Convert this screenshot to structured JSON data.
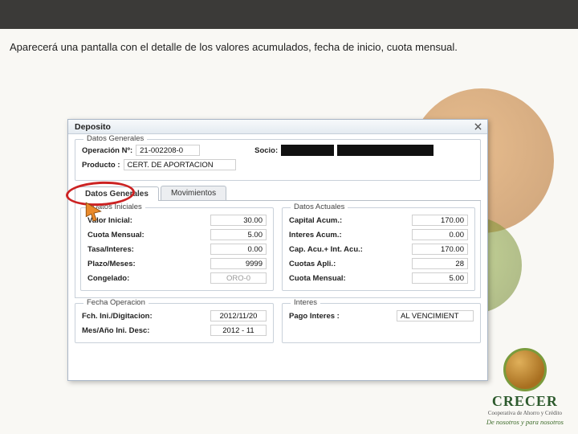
{
  "intro_text": "Aparecerá una pantalla con el detalle de los valores acumulados, fecha de inicio, cuota mensual.",
  "window": {
    "title": "Deposito"
  },
  "datos_generales": {
    "legend": "Datos Generales",
    "operacion_label": "Operación Nº:",
    "operacion_value": "21-002208-0",
    "socio_label": "Socio:",
    "producto_label": "Producto :",
    "producto_value": "CERT. DE APORTACION"
  },
  "tabs": {
    "tab1": "Datos Generales",
    "tab2": "Movimientos"
  },
  "datos_iniciales": {
    "legend": "Datos Iniciales",
    "valor_inicial_label": "Valor Inicial:",
    "valor_inicial": "30.00",
    "cuota_mensual_label": "Cuota Mensual:",
    "cuota_mensual": "5.00",
    "tasa_label": "Tasa/Interes:",
    "tasa": "0.00",
    "plazo_label": "Plazo/Meses:",
    "plazo": "9999",
    "congelado_label": "Congelado:",
    "congelado": "ORO-0"
  },
  "datos_actuales": {
    "legend": "Datos Actuales",
    "capital_label": "Capital Acum.:",
    "capital": "170.00",
    "interes_label": "Interes Acum.:",
    "interes": "0.00",
    "capint_label": "Cap. Acu.+ Int. Acu.:",
    "capint": "170.00",
    "cuotas_apli_label": "Cuotas Apli.:",
    "cuotas_apli": "28",
    "cuota_mensual_label": "Cuota Mensual:",
    "cuota_mensual": "5.00"
  },
  "fecha_operacion": {
    "legend": "Fecha Operacion",
    "fch_ini_label": "Fch. Ini./Digitacion:",
    "fch_ini": "2012/11/20",
    "mes_ano_label": "Mes/Año Ini. Desc:",
    "mes_ano": "2012 - 11"
  },
  "interes_box": {
    "legend": "Interes",
    "pago_label": "Pago Interes :",
    "pago": "AL VENCIMIENT"
  },
  "brand": {
    "name": "CRECER",
    "sub": "Cooperativa de Ahorro y Crédito",
    "slogan": "De nosotros y para nosotros"
  }
}
